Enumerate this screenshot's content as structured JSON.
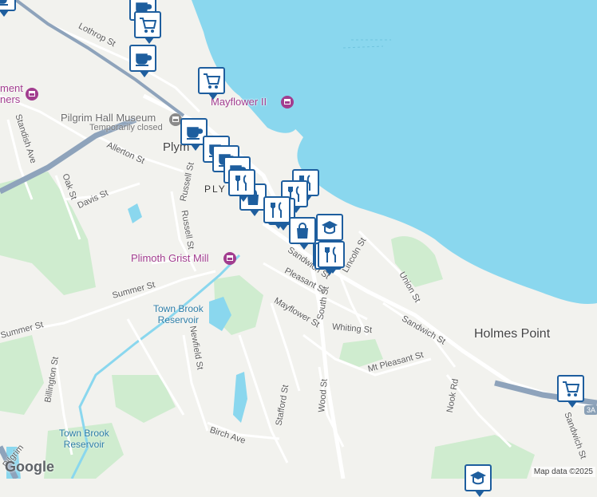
{
  "map": {
    "colors": {
      "water": "#8ad7ee",
      "land": "#f2f2ee",
      "park": "#cfeccf",
      "road": "#ffffff",
      "highway": "#8ea3bb",
      "marker": "#1e5e9e",
      "poi": "#a23d8f"
    },
    "places": {
      "town_top": "Plym",
      "town_mid": "PLY",
      "holmes_point": "Holmes Point",
      "town_brook_reservoir_upper": "Town Brook\nReservoir",
      "town_brook_reservoir_lower": "Town Brook\nReservoir",
      "partial_left": "ment\nners"
    },
    "pois": {
      "pilgrim_hall": "Pilgrim Hall Museum",
      "pilgrim_hall_status": "Temporarily closed",
      "mayflower": "Mayflower II",
      "grist_mill": "Plimoth Grist Mill"
    },
    "streets": {
      "lothrop": "Lothrop St",
      "standish": "Standish Ave",
      "allerton": "Allerton St",
      "oak": "Oak St",
      "davis": "Davis St",
      "russell_a": "Russell St",
      "russell_b": "Russell St",
      "summer_a": "Summer St",
      "summer_b": "Summer St",
      "pleasant": "Pleasant St",
      "mayflower": "Mayflower St",
      "south": "South St",
      "whiting": "Whiting St",
      "sandwich_a": "Sandwich St",
      "sandwich_b": "Sandwich St",
      "sandwich_c": "Sandwich St",
      "lincoln": "Lincoln St",
      "union": "Union St",
      "mt_pleasant": "Mt Pleasant St",
      "nook": "Nook Rd",
      "newfield": "Newfield St",
      "billington": "Billington St",
      "stafford": "Stafford St",
      "wood": "Wood St",
      "birch": "Birch Ave",
      "pilgrim": "Pilgrim",
      "route": "3A"
    },
    "attribution": "Map data ©2025",
    "logo": "Google"
  },
  "markers": [
    {
      "icon": "coffee-icon"
    },
    {
      "icon": "coffee-icon"
    },
    {
      "icon": "cart-icon"
    },
    {
      "icon": "coffee-icon"
    },
    {
      "icon": "cart-icon"
    },
    {
      "icon": "restaurant-icon"
    },
    {
      "icon": "coffee-icon"
    },
    {
      "icon": "restaurant-icon"
    },
    {
      "icon": "coffee-icon"
    },
    {
      "icon": "restaurant-icon"
    },
    {
      "icon": "coffee-icon"
    },
    {
      "icon": "shopping-bag-icon"
    },
    {
      "icon": "restaurant-icon"
    },
    {
      "icon": "coffee-icon"
    },
    {
      "icon": "restaurant-icon"
    },
    {
      "icon": "restaurant-icon"
    },
    {
      "icon": "shopping-bag-icon"
    },
    {
      "icon": "school-icon"
    },
    {
      "icon": "restaurant-icon"
    },
    {
      "icon": "restaurant-icon"
    },
    {
      "icon": "cart-icon"
    },
    {
      "icon": "school-icon"
    }
  ]
}
